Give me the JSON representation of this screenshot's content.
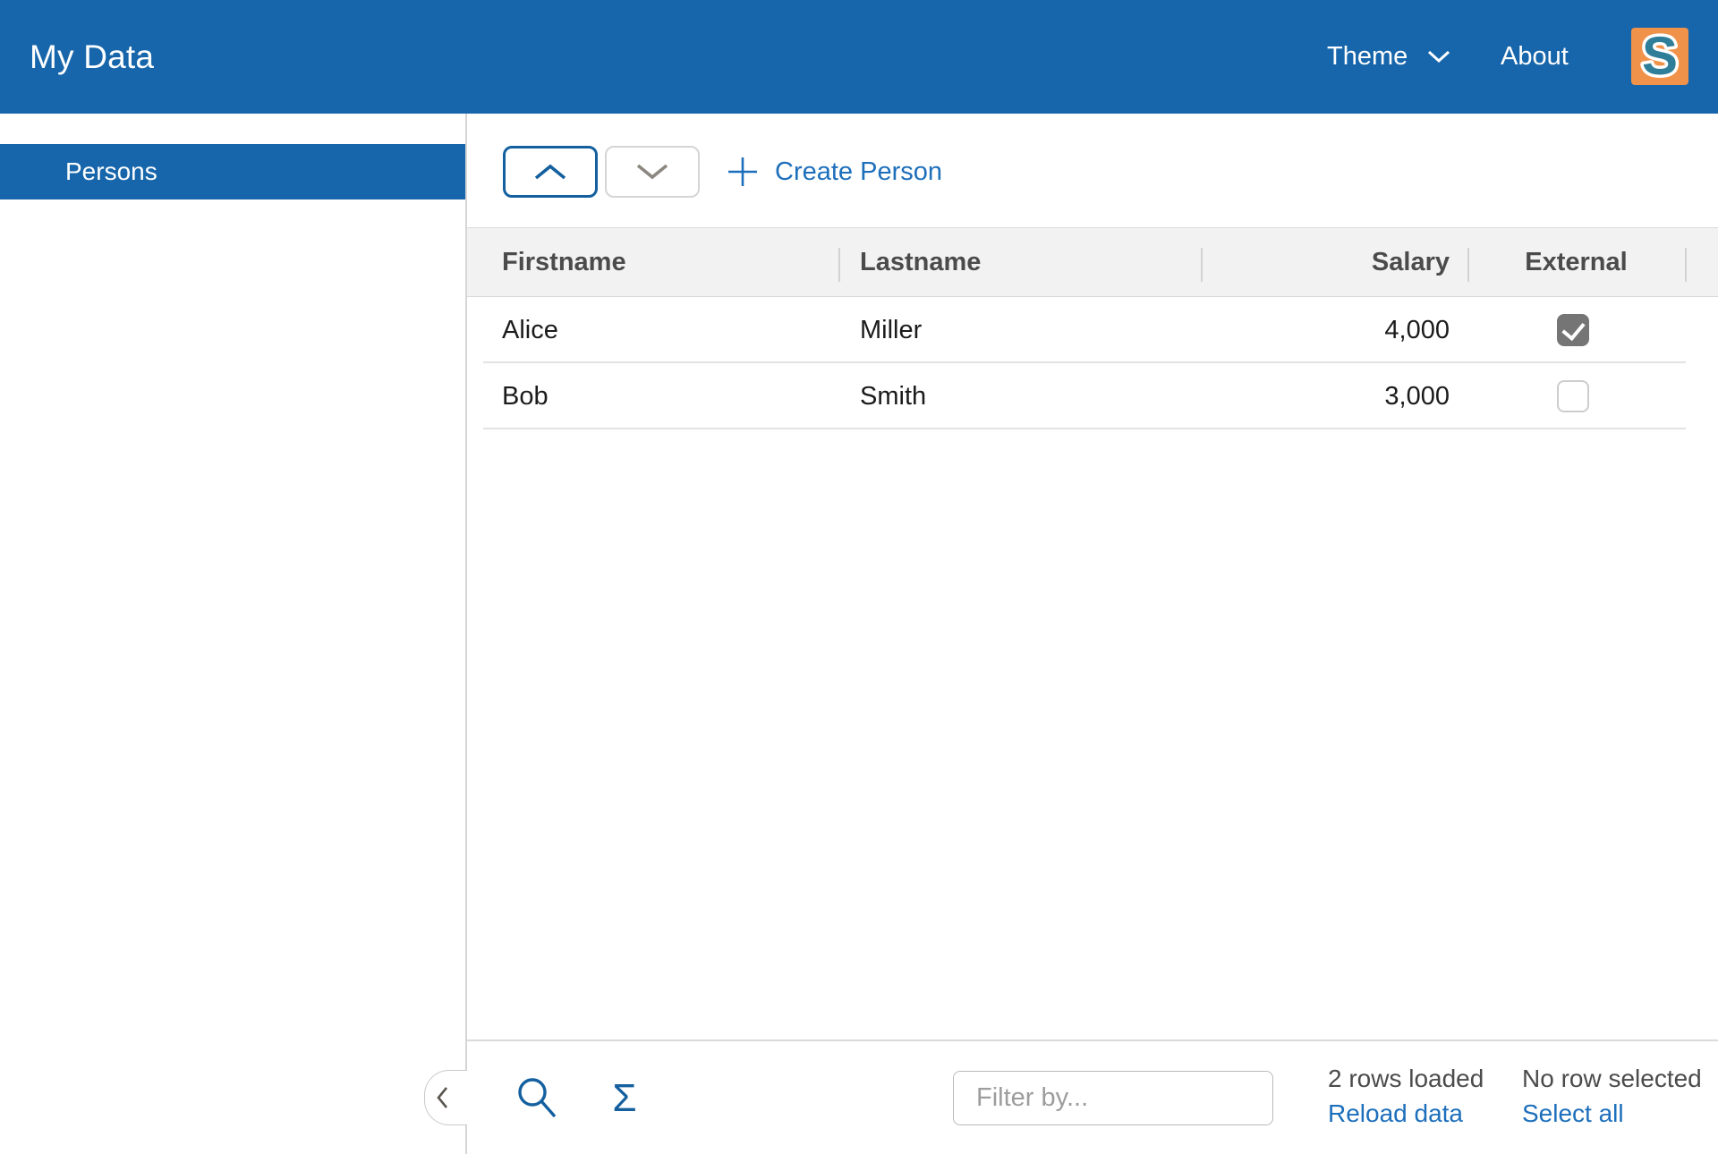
{
  "header": {
    "title": "My Data",
    "theme_label": "Theme",
    "about_label": "About",
    "logo_letter": "S"
  },
  "sidebar": {
    "items": [
      {
        "label": "Persons",
        "selected": true
      }
    ]
  },
  "toolbar": {
    "create_label": "Create Person"
  },
  "table": {
    "columns": [
      {
        "label": "Firstname",
        "align": "left"
      },
      {
        "label": "Lastname",
        "align": "left"
      },
      {
        "label": "Salary",
        "align": "right"
      },
      {
        "label": "External",
        "align": "center"
      }
    ],
    "rows": [
      {
        "firstname": "Alice",
        "lastname": "Miller",
        "salary": "4,000",
        "external": true
      },
      {
        "firstname": "Bob",
        "lastname": "Smith",
        "salary": "3,000",
        "external": false
      }
    ]
  },
  "footer": {
    "filter_placeholder": "Filter by...",
    "rows_loaded": "2 rows loaded",
    "reload_label": "Reload data",
    "selection_status": "No row selected",
    "select_all_label": "Select all",
    "sum_symbol": "Σ"
  },
  "colors": {
    "primary": "#1766ab",
    "link": "#1d6fbb",
    "iconBlue": "#14609f",
    "logoOrange": "#f0924a",
    "logoTeal": "#2f7e99",
    "checkGray": "#757575"
  }
}
